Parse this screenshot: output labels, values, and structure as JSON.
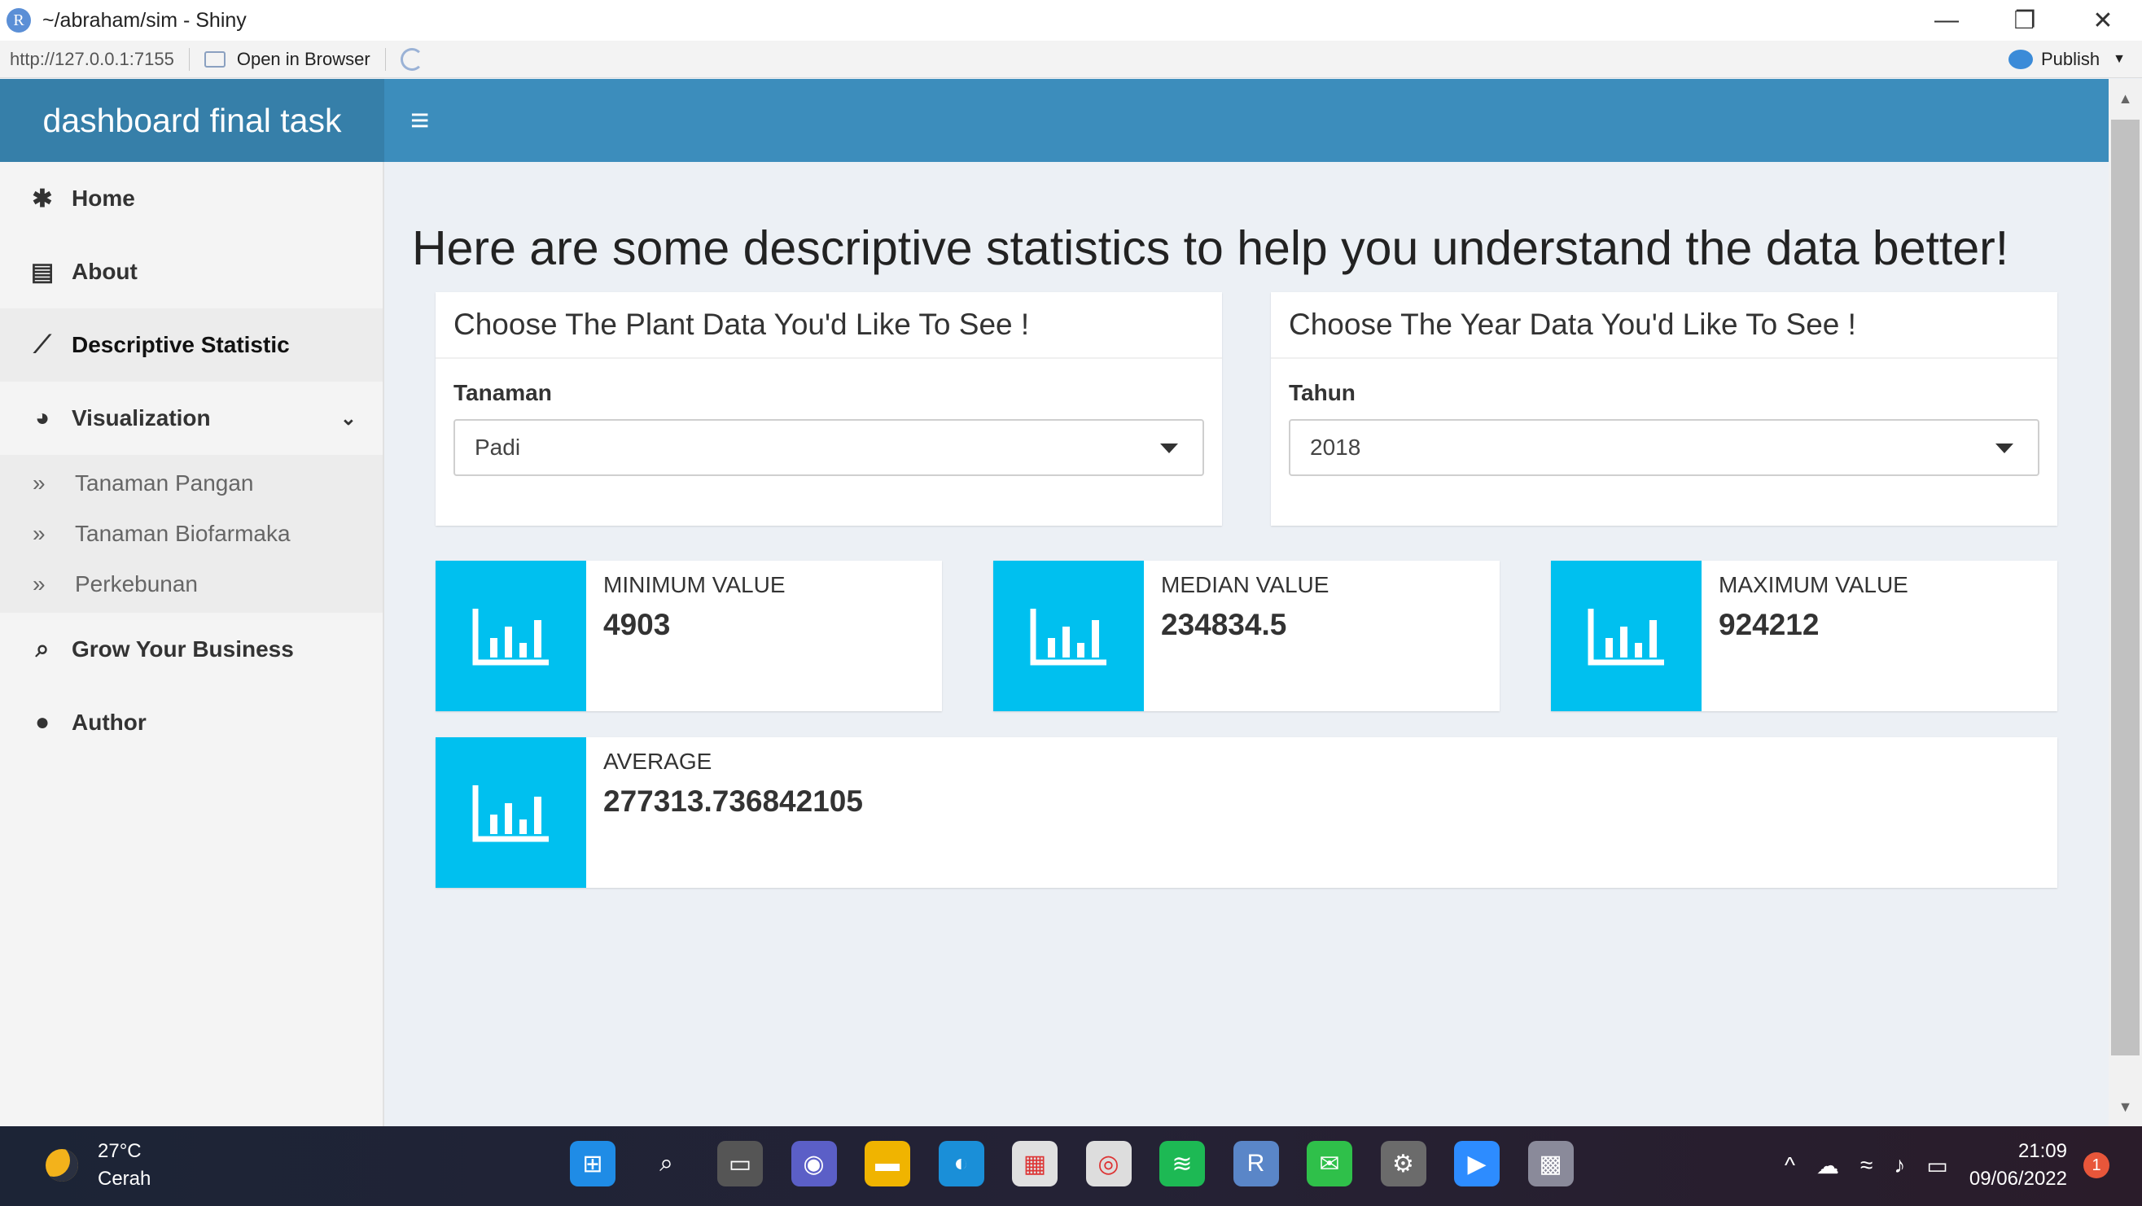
{
  "window": {
    "title": "~/abraham/sim - Shiny",
    "app_icon": "R",
    "controls": [
      "—",
      "❐",
      "✕"
    ]
  },
  "toolbar": {
    "url": "http://127.0.0.1:7155",
    "open_in_browser": "Open in Browser",
    "publish": "Publish"
  },
  "header": {
    "brand": "dashboard final task",
    "menu_icon": "≡"
  },
  "sidebar": {
    "items": [
      {
        "label": "Home",
        "icon": "✱"
      },
      {
        "label": "About",
        "icon": "▤"
      },
      {
        "label": "Descriptive Statistic",
        "icon": "⟋"
      },
      {
        "label": "Visualization",
        "icon": "◕"
      }
    ],
    "submenu": [
      {
        "label": "Tanaman Pangan",
        "icon": "»"
      },
      {
        "label": "Tanaman Biofarmaka",
        "icon": "»"
      },
      {
        "label": "Perkebunan",
        "icon": "»"
      }
    ],
    "bottom_items": [
      {
        "label": "Grow Your Business",
        "icon": "⌕"
      },
      {
        "label": "Author",
        "icon": "●"
      }
    ]
  },
  "main": {
    "title": "Here are some descriptive statistics to help you understand the data better!",
    "plant_box": {
      "header": "Choose The Plant Data You'd Like To See !",
      "label": "Tanaman",
      "selected": "Padi"
    },
    "year_box": {
      "header": "Choose The Year Data You'd Like To See !",
      "label": "Tahun",
      "selected": "2018"
    },
    "stats": [
      {
        "label": "Minimum Value",
        "value": "4903"
      },
      {
        "label": "Median Value",
        "value": "234834.5"
      },
      {
        "label": "Maximum Value",
        "value": "924212"
      },
      {
        "label": "Average",
        "value": "277313.736842105"
      }
    ],
    "accent_color": "#00c0ef",
    "header_color": "#3c8dbc"
  },
  "taskbar": {
    "weather_temp": "27°C",
    "weather_desc": "Cerah",
    "time": "21:09",
    "date": "09/06/2022",
    "notification_count": "1"
  }
}
